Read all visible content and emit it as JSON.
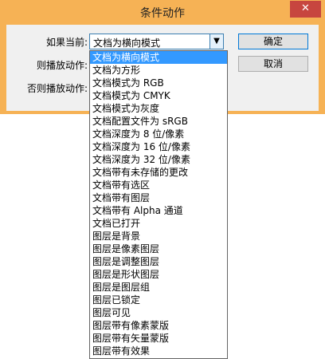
{
  "window": {
    "title": "条件动作",
    "close_label": "✕"
  },
  "form": {
    "if_label": "如果当前:",
    "then_label": "则播放动作:",
    "else_label": "否则播放动作:",
    "condition_value": "文档为横向模式"
  },
  "buttons": {
    "ok": "确定",
    "cancel": "取消"
  },
  "dropdown": {
    "items": [
      "文档为横向模式",
      "文档为方形",
      "文档模式为 RGB",
      "文档模式为 CMYK",
      "文档模式为灰度",
      "文档配置文件为 sRGB",
      "文档深度为 8 位/像素",
      "文档深度为 16 位/像素",
      "文档深度为 32 位/像素",
      "文档带有未存储的更改",
      "文档带有选区",
      "文档带有图层",
      "文档带有 Alpha 通道",
      "文档已打开",
      "图层是背景",
      "图层是像素图层",
      "图层是调整图层",
      "图层是形状图层",
      "图层是图层组",
      "图层已锁定",
      "图层可见",
      "图层带有像素蒙版",
      "图层带有矢量蒙版",
      "图层带有效果"
    ]
  }
}
